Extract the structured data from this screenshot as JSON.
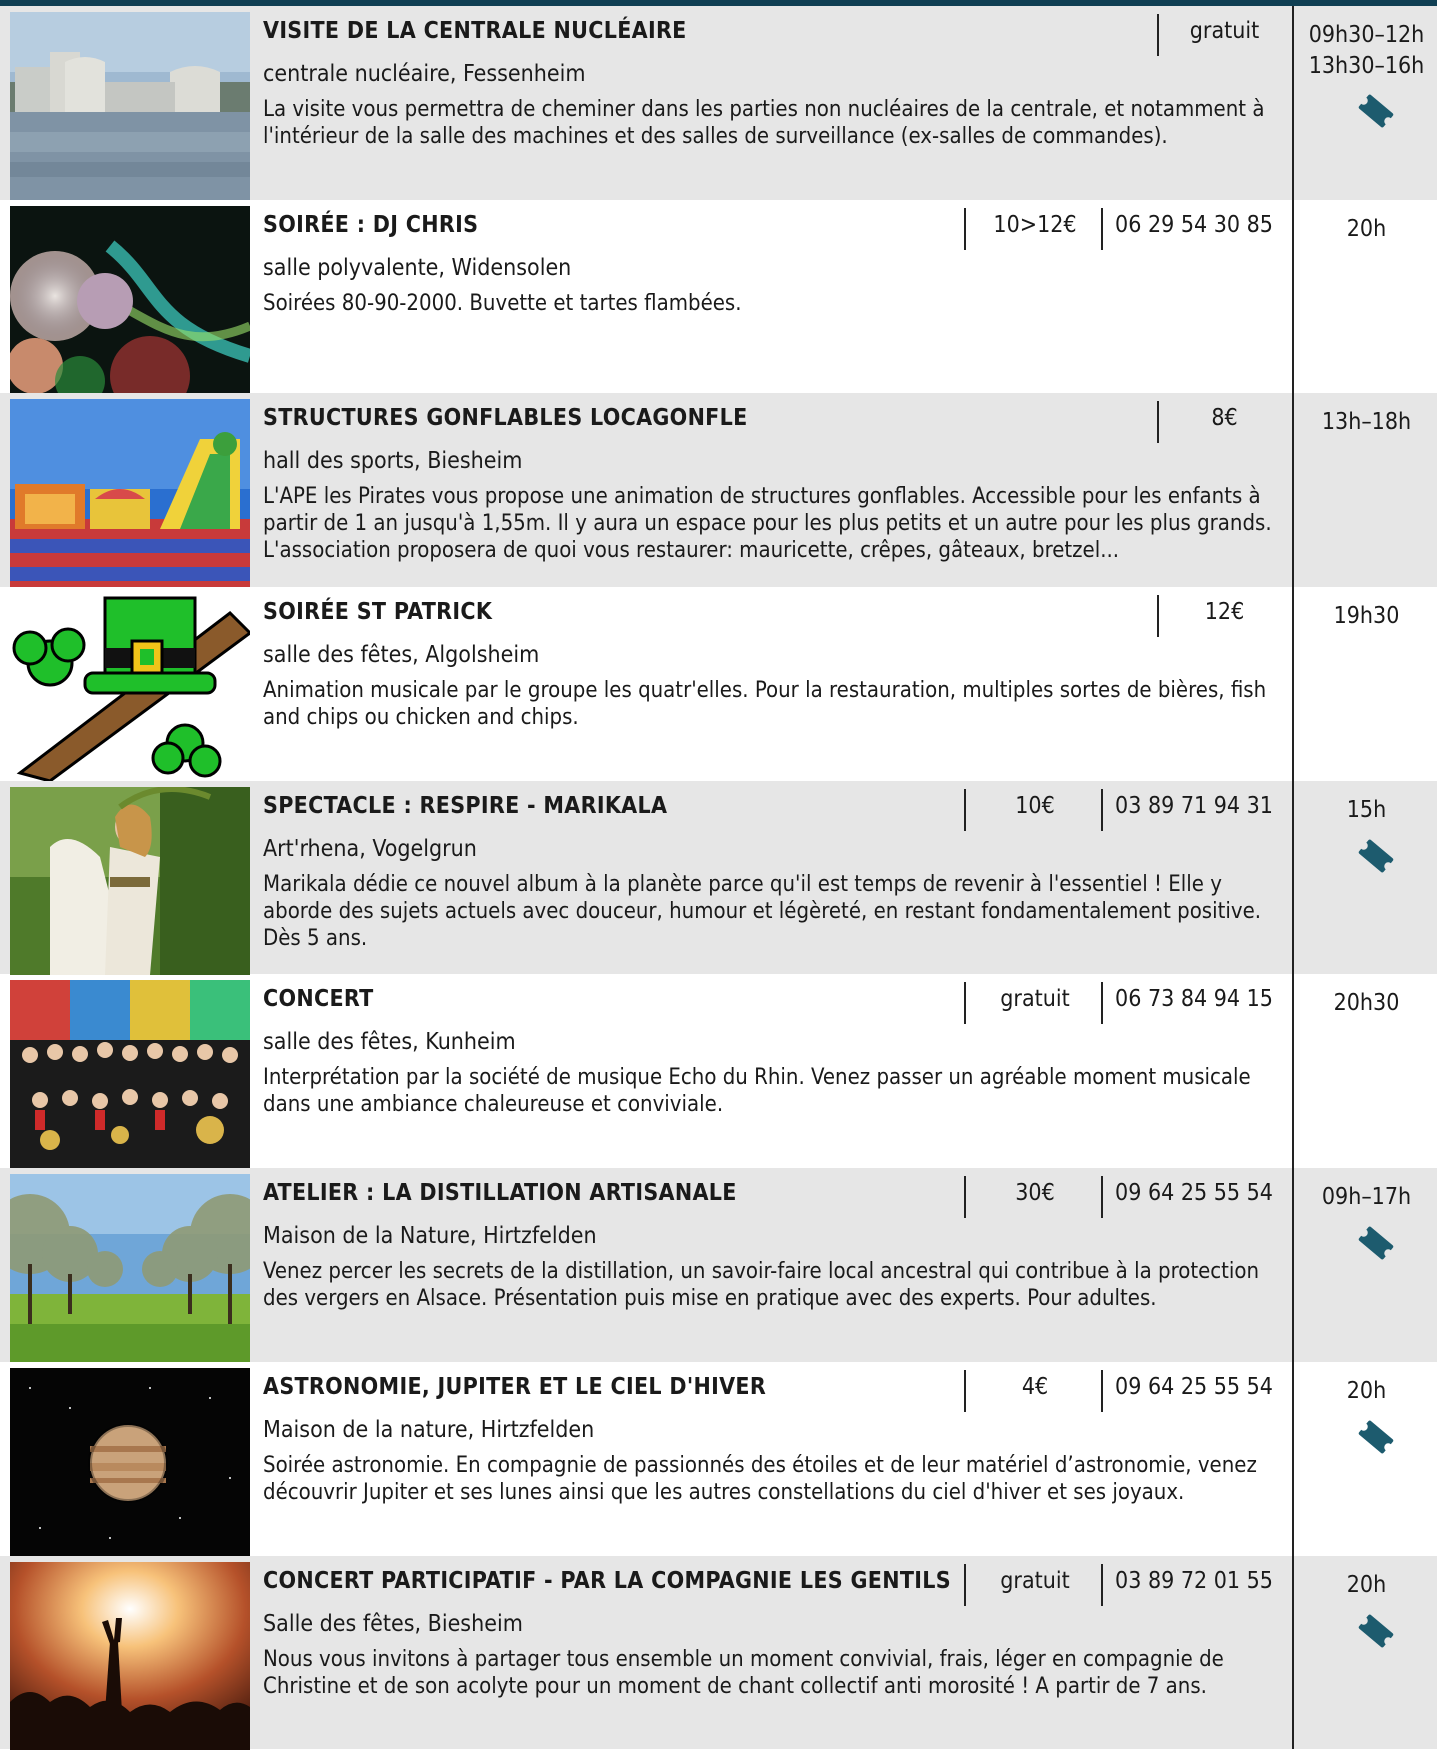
{
  "events": [
    {
      "title": "VISITE DE LA CENTRALE NUCLÉAIRE",
      "price": "gratuit",
      "phone": "",
      "place": "centrale nucléaire, Fessenheim",
      "desc": "La visite vous permettra de cheminer dans les parties non nucléaires de la centrale, et notamment à l'intérieur de la salle des machines et des salles de surveillance (ex-salles de commandes).",
      "time": "09h30–12h\n13h30–16h",
      "ticket": true,
      "image": "nuclear-plant-photo"
    },
    {
      "title": "SOIRÉE : DJ CHRIS",
      "price": "10>12€",
      "phone": "06 29 54 30 85",
      "place": "salle polyvalente, Widensolen",
      "desc": "Soirées 80-90-2000. Buvette et tartes flambées.",
      "time": "20h",
      "ticket": false,
      "image": "disco-balls-photo"
    },
    {
      "title": "STRUCTURES GONFLABLES LOCAGONFLE",
      "price": "8€",
      "phone": "",
      "place": "hall des sports, Biesheim",
      "desc": "L'APE les Pirates vous propose une animation de structures gonflables. Accessible pour les enfants à partir de 1 an jusqu'à 1,55m. Il y aura un espace pour les plus petits et un autre pour les plus grands. L'association proposera de quoi vous restaurer: mauricette, crêpes, gâteaux, bretzel...",
      "time": "13h–18h",
      "ticket": false,
      "image": "bouncy-castle-photo"
    },
    {
      "title": "SOIRÉE ST PATRICK",
      "price": "12€",
      "phone": "",
      "place": "salle des fêtes, Algolsheim",
      "desc": "Animation musicale par le groupe les quatr'elles. Pour la restauration, multiples sortes de bières, fish and chips ou chicken and chips.",
      "time": "19h30",
      "ticket": false,
      "image": "st-patrick-hat-illustration"
    },
    {
      "title": "SPECTACLE : RESPIRE - MARIKALA",
      "price": "10€",
      "phone": "03 89 71 94 31",
      "place": "Art'rhena, Vogelgrun",
      "desc": "Marikala dédie ce nouvel album à la planète parce qu'il est temps de revenir à l'essentiel ! Elle y aborde des sujets actuels avec douceur, humour et légèreté, en restant fondamentalement positive. Dès 5 ans.",
      "time": "15h",
      "ticket": true,
      "image": "singer-photo"
    },
    {
      "title": "CONCERT",
      "price": "gratuit",
      "phone": "06 73 84 94 15",
      "place": "salle des fêtes, Kunheim",
      "desc": "Interprétation par la société de musique Echo du Rhin. Venez passer un agréable moment musicale dans une ambiance chaleureuse et conviviale.",
      "time": "20h30",
      "ticket": false,
      "image": "brass-band-photo"
    },
    {
      "title": "ATELIER : LA DISTILLATION ARTISANALE",
      "price": "30€",
      "phone": "09 64 25 55 54",
      "place": "Maison de la Nature, Hirtzfelden",
      "desc": "Venez percer les secrets de la distillation, un savoir-faire local ancestral qui contribue à la protection des vergers en Alsace. Présentation puis mise en pratique avec des experts. Pour adultes.",
      "time": "09h–17h",
      "ticket": true,
      "image": "orchard-photo"
    },
    {
      "title": "ASTRONOMIE, JUPITER ET LE CIEL D'HIVER",
      "price": "4€",
      "phone": "09 64 25 55 54",
      "place": "Maison de la nature, Hirtzfelden",
      "desc": "Soirée astronomie. En compagnie de passionnés des étoiles et de leur matériel d’astronomie, venez découvrir Jupiter et ses lunes ainsi que les autres constellations du ciel d'hiver et ses joyaux.",
      "time": "20h",
      "ticket": true,
      "image": "jupiter-photo"
    },
    {
      "title": "CONCERT PARTICIPATIF - PAR LA COMPAGNIE LES GENTILS",
      "price": "gratuit",
      "phone": "03 89 72 01 55",
      "place": "Salle des fêtes, Biesheim",
      "desc": "Nous vous invitons à partager tous ensemble un moment convivial, frais, léger en compagnie de Christine et de son acolyte pour un moment de chant collectif anti morosité ! A partir de 7 ans.",
      "time": "20h",
      "ticket": true,
      "image": "concert-crowd-photo"
    }
  ],
  "colors": {
    "top_bar": "#0f3f53",
    "row_alt": "#e6e6e6",
    "ticket_icon": "#1d5b6e"
  }
}
